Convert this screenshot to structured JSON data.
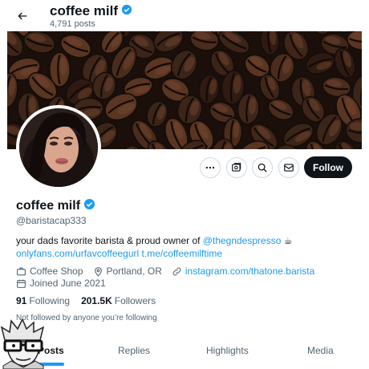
{
  "header": {
    "title": "coffee milf",
    "posts_count": "4,791 posts"
  },
  "profile": {
    "display_name": "coffee milf",
    "handle": "@baristacap333",
    "bio_prefix": "your dads favorite barista & proud owner of ",
    "bio_mention": "@thegndespresso",
    "bio_emoji": "☕",
    "bio_link1": "onlyfans.com/urfavcoffeegurl",
    "bio_link2": "t.me/coffeemilftime",
    "category": "Coffee Shop",
    "location": "Portland, OR",
    "website": "instagram.com/thatone.barista",
    "joined": "Joined June 2021",
    "following_count": "91",
    "following_label": "Following",
    "followers_count": "201.5K",
    "followers_label": "Followers",
    "not_followed_text": "Not followed by anyone you’re following"
  },
  "actions": {
    "follow_label": "Follow"
  },
  "tabs": [
    {
      "label": "Posts"
    },
    {
      "label": "Replies"
    },
    {
      "label": "Highlights"
    },
    {
      "label": "Media"
    }
  ],
  "colors": {
    "accent": "#1d9bf0",
    "text": "#0f1419",
    "secondary": "#536471"
  }
}
